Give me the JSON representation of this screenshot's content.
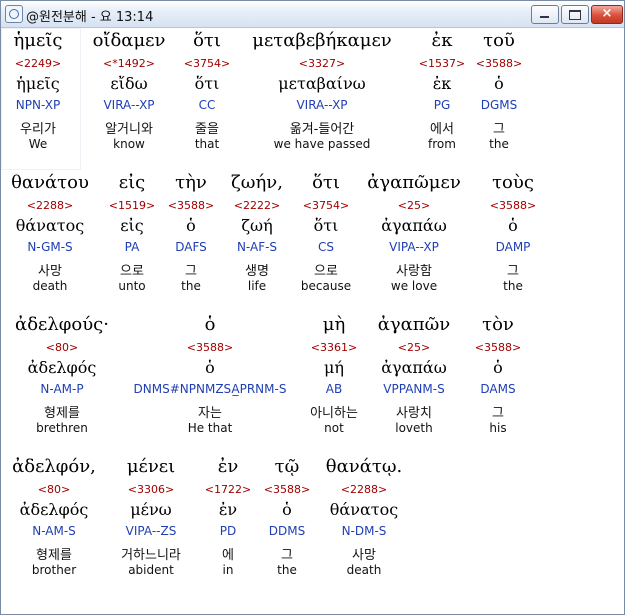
{
  "window": {
    "title": "@원전분해 - 요 13:14",
    "buttons": {
      "minimize": "minimize",
      "maximize": "maximize",
      "close": "×"
    }
  },
  "rows": [
    {
      "words": [
        {
          "greek": "ἡμεῖς",
          "number": "<2249>",
          "lemma": "ἡμεῖς",
          "parse": "NPN-XP",
          "korean": "우리가",
          "english": "We"
        },
        {
          "greek": "οἴδαμεν",
          "number": "<*1492>",
          "lemma": "εἴδω",
          "parse": "VIRA--XP",
          "korean": "알거니와",
          "english": "know"
        },
        {
          "greek": "ὅτι",
          "number": "<3754>",
          "lemma": "ὅτι",
          "parse": "CC",
          "korean": "줄을",
          "english": "that"
        },
        {
          "greek": "μεταβεβήκαμεν",
          "number": "<3327>",
          "lemma": "μεταβαίνω",
          "parse": "VIRA--XP",
          "korean": "옮겨-들어간",
          "english": "we have passed"
        },
        {
          "greek": "ἐκ",
          "number": "<1537>",
          "lemma": "ἐκ",
          "parse": "PG",
          "korean": "에서",
          "english": "from"
        },
        {
          "greek": "τοῦ",
          "number": "<3588>",
          "lemma": "ὁ",
          "parse": "DGMS",
          "korean": "그",
          "english": "the"
        }
      ]
    },
    {
      "words": [
        {
          "greek": "θανάτου",
          "number": "<2288>",
          "lemma": "θάνατος",
          "parse": "N-GM-S",
          "korean": "사망",
          "english": "death"
        },
        {
          "greek": "εἰς",
          "number": "<1519>",
          "lemma": "εἰς",
          "parse": "PA",
          "korean": "으로",
          "english": "unto"
        },
        {
          "greek": "τὴν",
          "number": "<3588>",
          "lemma": "ὁ",
          "parse": "DAFS",
          "korean": "그",
          "english": "the"
        },
        {
          "greek": "ζωήν,",
          "number": "<2222>",
          "lemma": "ζωή",
          "parse": "N-AF-S",
          "korean": "생명",
          "english": "life"
        },
        {
          "greek": "ὅτι",
          "number": "<3754>",
          "lemma": "ὅτι",
          "parse": "CS",
          "korean": "으로",
          "english": "because"
        },
        {
          "greek": "ἀγαπῶμεν",
          "number": "<25>",
          "lemma": "ἀγαπάω",
          "parse": "VIPA--XP",
          "korean": "사랑함",
          "english": "we love"
        },
        {
          "greek": "τοὺς",
          "number": "<3588>",
          "lemma": "ὁ",
          "parse": "DAMP",
          "korean": "그",
          "english": "the"
        }
      ]
    },
    {
      "words": [
        {
          "greek": "ἀδελφούς·",
          "number": "<80>",
          "lemma": "ἀδελφός",
          "parse": "N-AM-P",
          "korean": "형제를",
          "english": "brethren"
        },
        {
          "greek": "ὁ",
          "number": "<3588>",
          "lemma": "ὁ",
          "parse": "DNMS#NPNMZSA̲PRNM-S",
          "korean": "자는",
          "english": "He that"
        },
        {
          "greek": "μὴ",
          "number": "<3361>",
          "lemma": "μή",
          "parse": "AB",
          "korean": "아니하는",
          "english": "not"
        },
        {
          "greek": "ἀγαπῶν",
          "number": "<25>",
          "lemma": "ἀγαπάω",
          "parse": "VPPANM-S",
          "korean": "사랑치",
          "english": "loveth"
        },
        {
          "greek": "τὸν",
          "number": "<3588>",
          "lemma": "ὁ",
          "parse": "DAMS",
          "korean": "그",
          "english": "his"
        }
      ]
    },
    {
      "words": [
        {
          "greek": "ἀδελφόν,",
          "number": "<80>",
          "lemma": "ἀδελφός",
          "parse": "N-AM-S",
          "korean": "형제를",
          "english": "brother"
        },
        {
          "greek": "μένει",
          "number": "<3306>",
          "lemma": "μένω",
          "parse": "VIPA--ZS",
          "korean": "거하느니라",
          "english": "abident"
        },
        {
          "greek": "ἐν",
          "number": "<1722>",
          "lemma": "ἐν",
          "parse": "PD",
          "korean": "에",
          "english": "in"
        },
        {
          "greek": "τῷ",
          "number": "<3588>",
          "lemma": "ὁ",
          "parse": "DDMS",
          "korean": "그",
          "english": "the"
        },
        {
          "greek": "θανάτῳ.",
          "number": "<2288>",
          "lemma": "θάνατος",
          "parse": "N-DM-S",
          "korean": "사망",
          "english": "death"
        }
      ]
    }
  ]
}
